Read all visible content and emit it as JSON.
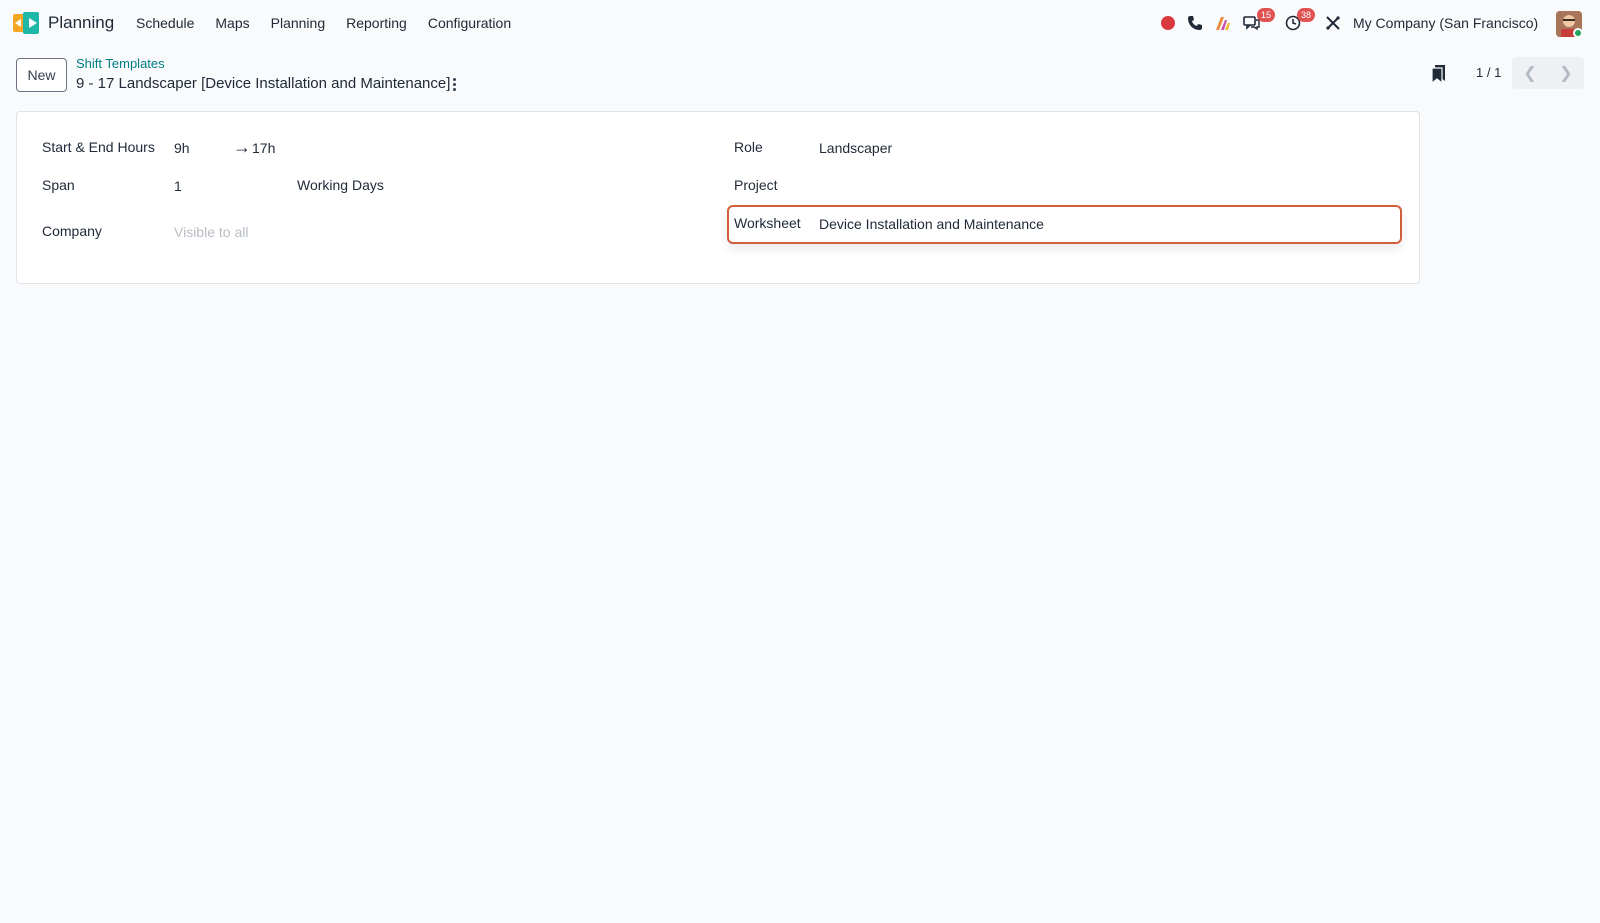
{
  "navbar": {
    "app_name": "Planning",
    "menu": [
      "Schedule",
      "Maps",
      "Planning",
      "Reporting",
      "Configuration"
    ],
    "badges": {
      "messages": "15",
      "activities": "38"
    },
    "company": "My Company (San Francisco)",
    "icons": [
      "record-icon",
      "phone-icon",
      "ai-icon",
      "chat-icon",
      "clock-icon",
      "tools-icon"
    ]
  },
  "control_panel": {
    "new_label": "New",
    "breadcrumb": "Shift Templates",
    "title": "9 - 17 Landscaper [Device Installation and Maintenance]",
    "pager": "1 / 1"
  },
  "form": {
    "left": {
      "hours_label": "Start & End Hours",
      "start_hour": "9h",
      "arrow": "→",
      "end_hour": "17h",
      "span_label": "Span",
      "span_value": "1",
      "span_unit": "Working Days",
      "company_label": "Company",
      "company_placeholder": "Visible to all"
    },
    "right": {
      "role_label": "Role",
      "role_value": "Landscaper",
      "project_label": "Project",
      "project_value": "",
      "worksheet_label": "Worksheet",
      "worksheet_value": "Device Installation and Maintenance"
    }
  },
  "colors": {
    "accent": "#017e84",
    "highlight": "#d35f3a",
    "badge": "#e05252"
  }
}
